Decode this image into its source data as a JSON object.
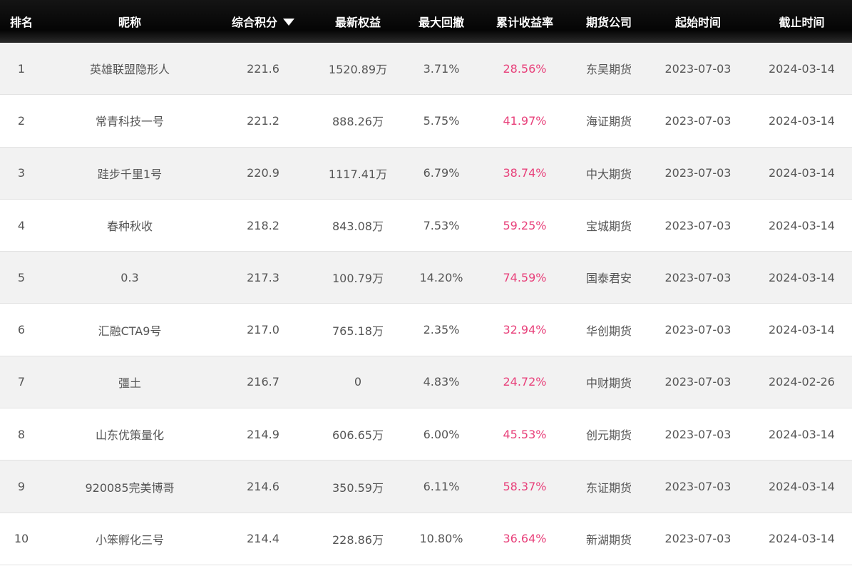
{
  "header": {
    "rank": "排名",
    "name": "昵称",
    "score": "综合积分",
    "equity": "最新权益",
    "drawdown": "最大回撤",
    "return": "累计收益率",
    "company": "期货公司",
    "start": "起始时间",
    "end": "截止时间"
  },
  "sort_icon": "caret-down-icon",
  "accent_color": "#e8407a",
  "rows": [
    {
      "rank": "1",
      "name": "英雄联盟隐形人",
      "score": "221.6",
      "equity": "1520.89万",
      "drawdown": "3.71%",
      "return": "28.56%",
      "company": "东吴期货",
      "start": "2023-07-03",
      "end": "2024-03-14"
    },
    {
      "rank": "2",
      "name": "常青科技一号",
      "score": "221.2",
      "equity": "888.26万",
      "drawdown": "5.75%",
      "return": "41.97%",
      "company": "海证期货",
      "start": "2023-07-03",
      "end": "2024-03-14"
    },
    {
      "rank": "3",
      "name": "跬步千里1号",
      "score": "220.9",
      "equity": "1117.41万",
      "drawdown": "6.79%",
      "return": "38.74%",
      "company": "中大期货",
      "start": "2023-07-03",
      "end": "2024-03-14"
    },
    {
      "rank": "4",
      "name": "春种秋收",
      "score": "218.2",
      "equity": "843.08万",
      "drawdown": "7.53%",
      "return": "59.25%",
      "company": "宝城期货",
      "start": "2023-07-03",
      "end": "2024-03-14"
    },
    {
      "rank": "5",
      "name": "0.3",
      "score": "217.3",
      "equity": "100.79万",
      "drawdown": "14.20%",
      "return": "74.59%",
      "company": "国泰君安",
      "start": "2023-07-03",
      "end": "2024-03-14"
    },
    {
      "rank": "6",
      "name": "汇融CTA9号",
      "score": "217.0",
      "equity": "765.18万",
      "drawdown": "2.35%",
      "return": "32.94%",
      "company": "华创期货",
      "start": "2023-07-03",
      "end": "2024-03-14"
    },
    {
      "rank": "7",
      "name": "彊土",
      "score": "216.7",
      "equity": "0",
      "drawdown": "4.83%",
      "return": "24.72%",
      "company": "中财期货",
      "start": "2023-07-03",
      "end": "2024-02-26"
    },
    {
      "rank": "8",
      "name": "山东优策量化",
      "score": "214.9",
      "equity": "606.65万",
      "drawdown": "6.00%",
      "return": "45.53%",
      "company": "创元期货",
      "start": "2023-07-03",
      "end": "2024-03-14"
    },
    {
      "rank": "9",
      "name": "920085完美博哥",
      "score": "214.6",
      "equity": "350.59万",
      "drawdown": "6.11%",
      "return": "58.37%",
      "company": "东证期货",
      "start": "2023-07-03",
      "end": "2024-03-14"
    },
    {
      "rank": "10",
      "name": "小笨孵化三号",
      "score": "214.4",
      "equity": "228.86万",
      "drawdown": "10.80%",
      "return": "36.64%",
      "company": "新湖期货",
      "start": "2023-07-03",
      "end": "2024-03-14"
    }
  ]
}
